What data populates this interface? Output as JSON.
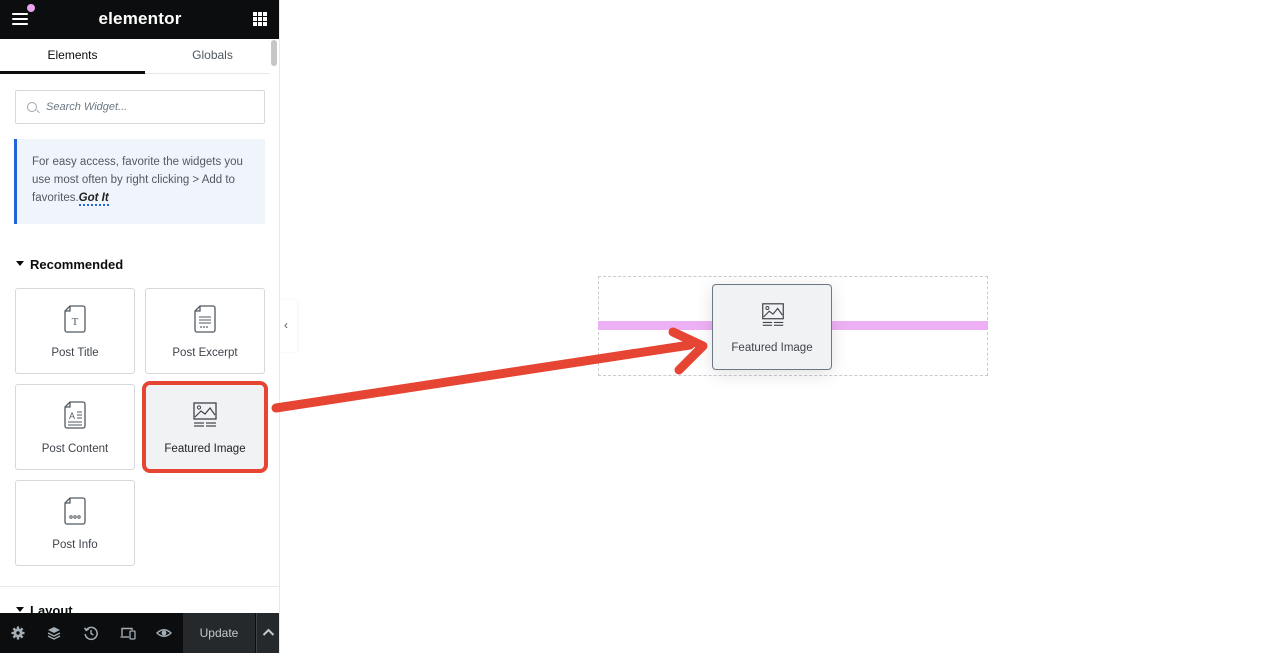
{
  "app": {
    "brand": "elementor"
  },
  "tabs": [
    {
      "label": "Elements",
      "active": true
    },
    {
      "label": "Globals",
      "active": false
    }
  ],
  "search": {
    "placeholder": "Search Widget..."
  },
  "tip": {
    "text": "For easy access, favorite the widgets you use most often by right clicking > Add to favorites.",
    "action": "Got It"
  },
  "sections": {
    "recommended": "Recommended",
    "layout": "Layout"
  },
  "widgets": [
    {
      "label": "Post Title",
      "icon": "post-title-icon"
    },
    {
      "label": "Post Excerpt",
      "icon": "post-excerpt-icon"
    },
    {
      "label": "Post Content",
      "icon": "post-content-icon"
    },
    {
      "label": "Featured Image",
      "icon": "featured-image-icon",
      "highlighted": true
    },
    {
      "label": "Post Info",
      "icon": "post-info-icon"
    }
  ],
  "bottombar": {
    "icons": [
      "gear-icon",
      "layers-icon",
      "history-icon",
      "responsive-icon",
      "eye-icon"
    ],
    "update_label": "Update"
  },
  "canvas": {
    "dragged_widget_label": "Featured Image"
  },
  "colors": {
    "highlight": "#e64534",
    "drop_indicator": "#eeb0f5",
    "tip_accent": "#2563d8",
    "topbar": "#0c0d0e"
  }
}
